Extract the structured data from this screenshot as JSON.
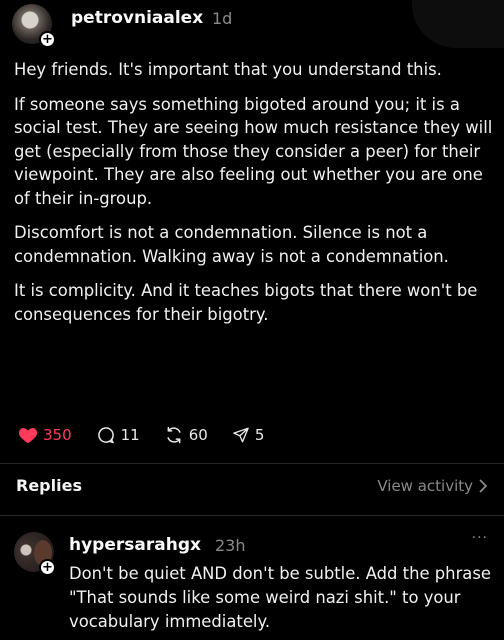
{
  "post": {
    "username": "petrovniaalex",
    "timestamp": "1d",
    "paragraphs": [
      "Hey friends. It's important that you understand this.",
      "If someone says something bigoted around you; it is a social test. They are seeing how much resistance they will get (especially from those they consider a peer) for their viewpoint. They are also feeling out whether you are one of their in-group.",
      "Discomfort is not a condemnation. Silence is not a condemnation. Walking away is not a condemnation.",
      "It is complicity. And it teaches bigots that there won't be consequences for their bigotry."
    ],
    "actions": {
      "likes": "350",
      "comments": "11",
      "reposts": "60",
      "shares": "5"
    }
  },
  "replies_section": {
    "title": "Replies",
    "view_activity": "View activity"
  },
  "reply": {
    "username": "hypersarahgx",
    "timestamp": "23h",
    "more": "···",
    "text": "Don't be quiet AND don't be subtle. Add the phrase \"That sounds like some weird nazi shit.\" to your vocabulary immediately."
  },
  "icons": {
    "follow_badge": "+",
    "like": "heart-icon",
    "comment": "comment-icon",
    "repost": "repost-icon",
    "share": "share-icon",
    "chevron": "chevron-right-icon"
  },
  "colors": {
    "background": "#000000",
    "like_red": "#ff3b5c",
    "muted": "#8a8a8a"
  }
}
